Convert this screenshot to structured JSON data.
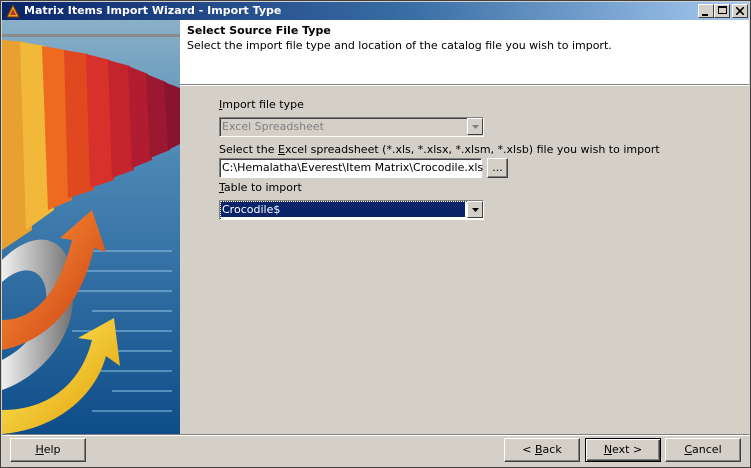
{
  "window": {
    "title": "Matrix Items Import Wizard - Import Type"
  },
  "header": {
    "title": "Select Source File Type",
    "description": "Select the import file type and location of the catalog file you wish to import."
  },
  "form": {
    "file_type_label_prefix": "",
    "file_type_label_access": "I",
    "file_type_label_rest": "mport file type",
    "file_type_value": "Excel Spreadsheet",
    "spreadsheet_label_prefix": "Select the ",
    "spreadsheet_label_access": "E",
    "spreadsheet_label_rest": "xcel spreadsheet (*.xls, *.xlsx, *.xlsm, *.xlsb) file you wish to import",
    "file_path_value": "C:\\Hemalatha\\Everest\\Item Matrix\\Crocodile.xls",
    "browse_label": "...",
    "table_label_access": "T",
    "table_label_rest": "able to import",
    "table_value": "Crocodile$"
  },
  "buttons": {
    "help_access": "H",
    "help_rest": "elp",
    "back_prefix": "< ",
    "back_access": "B",
    "back_rest": "ack",
    "next_access": "N",
    "next_rest": "ext >",
    "cancel_access": "C",
    "cancel_rest": "ancel"
  },
  "icons": {
    "app": "wizard-app-icon",
    "minimize": "minimize-icon",
    "maximize": "maximize-icon",
    "close": "close-icon",
    "dropdown": "chevron-down-icon"
  },
  "colors": {
    "titlebar_start": "#0a246a",
    "titlebar_end": "#a6caf0",
    "selection": "#0a246a",
    "face": "#d4d0c8"
  }
}
